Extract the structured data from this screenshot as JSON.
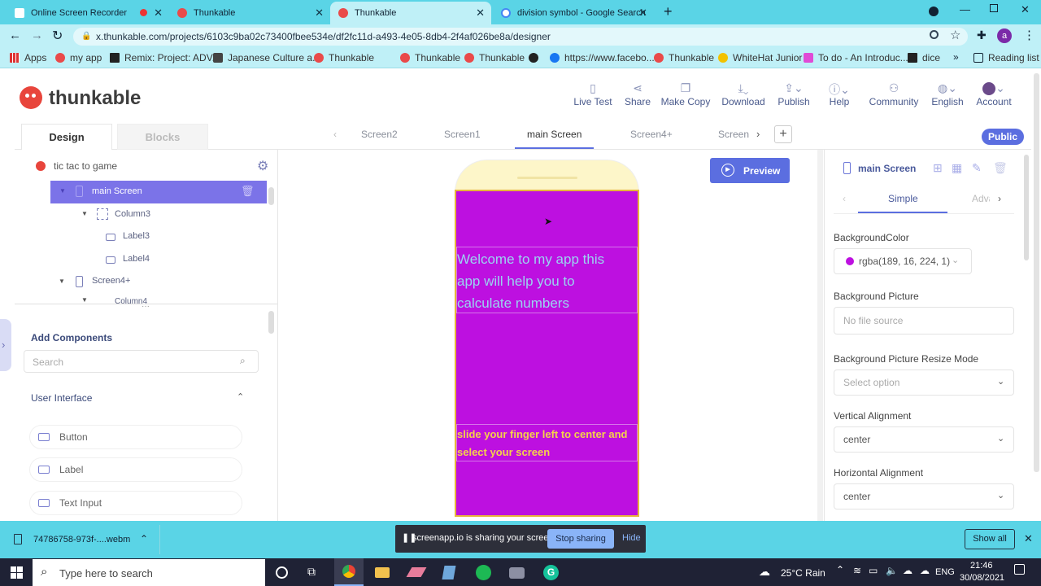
{
  "browser": {
    "tabs": [
      {
        "title": "Online Screen Recorder",
        "active": false
      },
      {
        "title": "Thunkable",
        "active": false
      },
      {
        "title": "Thunkable",
        "active": true
      },
      {
        "title": "division symbol - Google Search",
        "active": false
      }
    ],
    "url": "x.thunkable.com/projects/6103c9ba02c73400fbee534e/df2fc11d-a493-4e05-8db4-2f4af026be8a/designer",
    "bookmarks": [
      "Apps",
      "my app",
      "Remix: Project: ADV...",
      "Japanese Culture a...",
      "Thunkable",
      "Thunkable",
      "Thunkable",
      "https://www.facebo...",
      "Thunkable",
      "WhiteHat Junior",
      "To do - An Introduc...",
      "dice"
    ],
    "reading_list": "Reading list"
  },
  "app": {
    "logo": "thunkable",
    "toolbar": [
      {
        "label": "Live Test",
        "icon": "phone-icon"
      },
      {
        "label": "Share",
        "icon": "share-icon"
      },
      {
        "label": "Make Copy",
        "icon": "copy-icon"
      },
      {
        "label": "Download",
        "icon": "download-icon"
      },
      {
        "label": "Publish",
        "icon": "publish-icon"
      },
      {
        "label": "Help",
        "icon": "help-icon"
      },
      {
        "label": "Community",
        "icon": "community-icon"
      },
      {
        "label": "English",
        "icon": "globe-icon"
      },
      {
        "label": "Account",
        "icon": "avatar-icon"
      }
    ],
    "design_tab": "Design",
    "blocks_tab": "Blocks",
    "screen_tabs": [
      "Screen2",
      "Screen1",
      "main Screen",
      "Screen4+",
      "Screen"
    ],
    "public": "Public",
    "tree": {
      "project": "tic tac to game",
      "items": [
        "main Screen",
        "Column3",
        "Label3",
        "Label4",
        "Screen4+",
        "Column4"
      ]
    },
    "add_components": "Add Components",
    "search_placeholder": "Search",
    "user_interface": "User Interface",
    "components": [
      "Button",
      "Label",
      "Text Input"
    ],
    "preview": "Preview",
    "phone": {
      "welcome": "Welcome to my app this app will help you to calculate numbers",
      "slide": "slide your finger left to center and select your screen",
      "bg": "#bd10e0",
      "welcome_color": "#9ad4f0",
      "slide_color": "#f5d24a"
    },
    "props": {
      "screen_name": "main Screen",
      "simple": "Simple",
      "advanced": "Adva",
      "bg_color_label": "BackgroundColor",
      "bg_color_value": "rgba(189, 16, 224, 1)",
      "bg_picture_label": "Background Picture",
      "bg_picture_value": "No file source",
      "resize_label": "Background Picture Resize Mode",
      "resize_value": "Select option",
      "valign_label": "Vertical Alignment",
      "valign_value": "center",
      "halign_label": "Horizontal Alignment",
      "halign_value": "center"
    }
  },
  "download_bar": {
    "file": "74786758-973f-....webm",
    "sharing_text": "screenapp.io is sharing your screen.",
    "stop": "Stop sharing",
    "hide": "Hide",
    "show_all": "Show all"
  },
  "taskbar": {
    "search": "Type here to search",
    "weather": "25°C Rain",
    "lang": "ENG",
    "time": "21:46",
    "date": "30/08/2021"
  }
}
